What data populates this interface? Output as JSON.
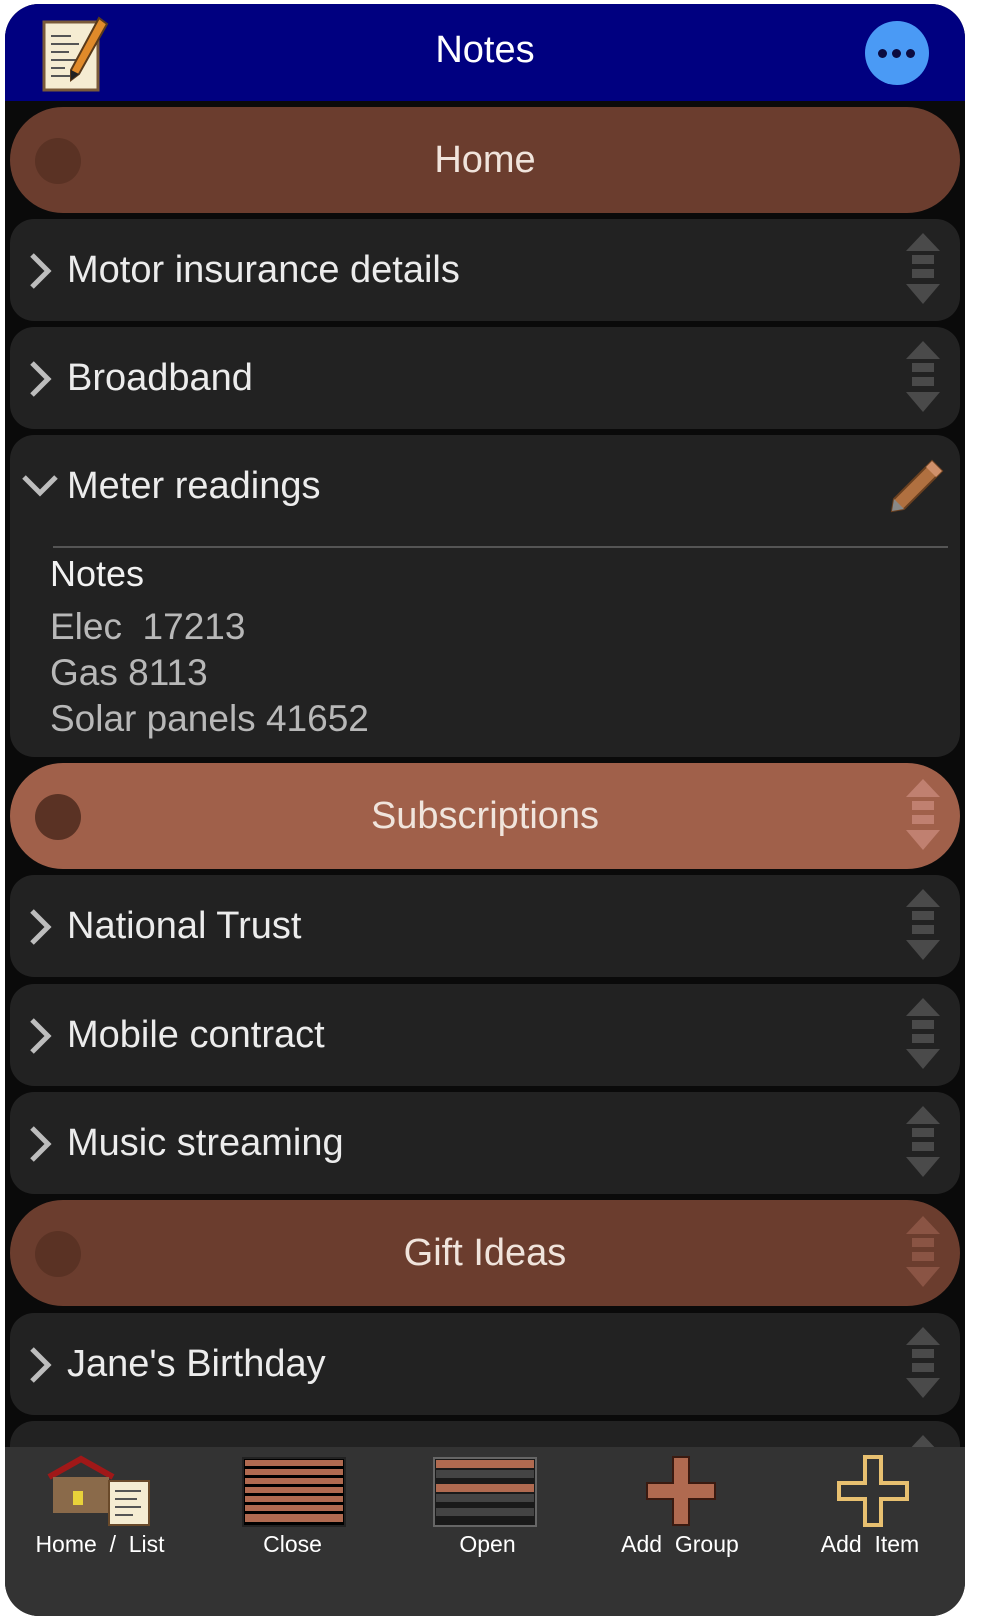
{
  "header": {
    "title": "Notes",
    "app_icon": "notepad-pencil-icon",
    "more_icon": "ellipsis-icon"
  },
  "list": {
    "home_group": {
      "label": "Home"
    },
    "items_home": [
      {
        "label": "Motor insurance details"
      },
      {
        "label": "Broadband"
      }
    ],
    "expanded_item": {
      "label": "Meter readings",
      "heading": "Notes",
      "lines": [
        "Elec  17213",
        "Gas 8113",
        "Solar panels 41652"
      ]
    },
    "subscriptions_group": {
      "label": "Subscriptions"
    },
    "items_subscriptions": [
      {
        "label": "National Trust"
      },
      {
        "label": "Mobile contract"
      },
      {
        "label": "Music streaming"
      }
    ],
    "gift_group": {
      "label": "Gift Ideas"
    },
    "items_gift": [
      {
        "label": "Jane's Birthday"
      }
    ]
  },
  "toolbar": {
    "home_list": "Home  /  List",
    "close": "Close",
    "open": "Open",
    "add_group": "Add  Group",
    "add_item": "Add  Item"
  },
  "colors": {
    "header_bg": "#000080",
    "group_brown": "#6b3d2e",
    "group_highlight": "#a0604a",
    "row_bg": "#222222",
    "more_button": "#4a9af5"
  }
}
